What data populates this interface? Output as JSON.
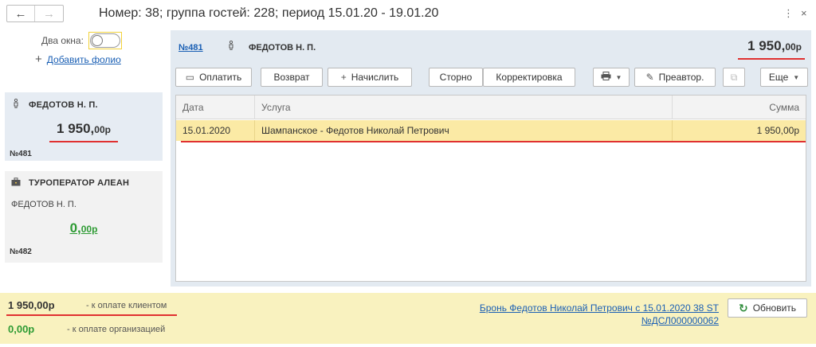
{
  "header": {
    "title": "Номер: 38; группа гостей: 228; период 15.01.20 - 19.01.20",
    "back_icon": "←",
    "forward_icon": "→",
    "more_icon": "⋮",
    "close_icon": "×"
  },
  "sidebar": {
    "two_windows_label": "Два окна:",
    "two_windows_on": false,
    "add_folio": "Добавить фолио",
    "folios": [
      {
        "icon": "person-icon",
        "name": "ФЕДОТОВ Н. П.",
        "sub": "",
        "amount_int": "1 950,",
        "amount_dec": "00р",
        "amount_color": "#333333",
        "number": "№481",
        "active": true
      },
      {
        "icon": "briefcase-icon",
        "name": "ТУРОПЕРАТОР АЛЕАН",
        "sub": "ФЕДОТОВ Н. П.",
        "amount_int": "0,",
        "amount_dec": "00р",
        "amount_color": "#2e9b34",
        "number": "№482",
        "active": false
      }
    ]
  },
  "main": {
    "folio_number": "№481",
    "guest_name": "ФЕДОТОВ Н. П.",
    "total_int": "1 950,",
    "total_dec": "00р",
    "toolbar": {
      "pay": "Оплатить",
      "refund": "Возврат",
      "charge": "Начислить",
      "storno": "Сторно",
      "correction": "Корректировка",
      "print_icon": "printer-icon",
      "preview": "Преавтор.",
      "more": "Еще"
    },
    "table": {
      "columns": [
        "Дата",
        "Услуга",
        "Сумма"
      ],
      "rows": [
        {
          "date": "15.01.2020",
          "service": "Шампанское - Федотов Николай Петрович",
          "amount": "1 950,00р"
        }
      ]
    }
  },
  "footer": {
    "client_amount": "1 950,00р",
    "client_label": "- к оплате клиентом",
    "org_amount": "0,00р",
    "org_label": "- к оплате организацией",
    "booking_line1": "Бронь Федотов Николай Петрович с 15.01.2020 38 ST",
    "booking_line2": "№ДСЛ000000062",
    "refresh": "Обновить"
  },
  "colors": {
    "accent_red": "#e03030",
    "link": "#1a5fb4",
    "selected_row": "#fbeaa5",
    "footer_bg": "#f9f2bf",
    "green": "#2e9b34"
  }
}
